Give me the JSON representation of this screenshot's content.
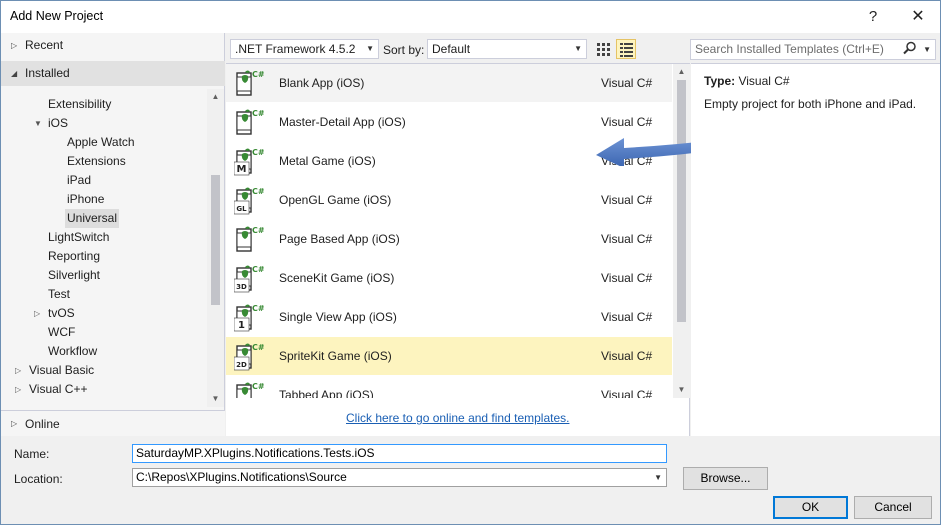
{
  "window": {
    "title": "Add New Project",
    "help_glyph": "?",
    "close_glyph": "✕"
  },
  "left": {
    "recent": "Recent",
    "installed": "Installed",
    "online": "Online",
    "tree": [
      {
        "label": "Extensibility",
        "indent": 1,
        "expander": ""
      },
      {
        "label": "iOS",
        "indent": 1,
        "expander": "▼"
      },
      {
        "label": "Apple Watch",
        "indent": 2,
        "expander": ""
      },
      {
        "label": "Extensions",
        "indent": 2,
        "expander": ""
      },
      {
        "label": "iPad",
        "indent": 2,
        "expander": ""
      },
      {
        "label": "iPhone",
        "indent": 2,
        "expander": ""
      },
      {
        "label": "Universal",
        "indent": 2,
        "expander": "",
        "selected": true
      },
      {
        "label": "LightSwitch",
        "indent": 1,
        "expander": ""
      },
      {
        "label": "Reporting",
        "indent": 1,
        "expander": ""
      },
      {
        "label": "Silverlight",
        "indent": 1,
        "expander": ""
      },
      {
        "label": "Test",
        "indent": 1,
        "expander": ""
      },
      {
        "label": "tvOS",
        "indent": 1,
        "expander": "▷"
      },
      {
        "label": "WCF",
        "indent": 1,
        "expander": ""
      },
      {
        "label": "Workflow",
        "indent": 1,
        "expander": ""
      },
      {
        "label": "Visual Basic",
        "indent": 0,
        "expander": "▷"
      },
      {
        "label": "Visual C++",
        "indent": 0,
        "expander": "▷"
      }
    ]
  },
  "toolbar": {
    "framework": ".NET Framework 4.5.2",
    "sort_label": "Sort by:",
    "sort_value": "Default",
    "search_placeholder": "Search Installed Templates (Ctrl+E)"
  },
  "templates": [
    {
      "name": "Blank App (iOS)",
      "lang": "Visual C#",
      "glyph": "",
      "state": "hover"
    },
    {
      "name": "Master-Detail App (iOS)",
      "lang": "Visual C#",
      "glyph": "",
      "state": ""
    },
    {
      "name": "Metal Game (iOS)",
      "lang": "Visual C#",
      "glyph": "M",
      "state": ""
    },
    {
      "name": "OpenGL Game (iOS)",
      "lang": "Visual C#",
      "glyph": "GL",
      "state": ""
    },
    {
      "name": "Page Based App (iOS)",
      "lang": "Visual C#",
      "glyph": "",
      "state": ""
    },
    {
      "name": "SceneKit Game (iOS)",
      "lang": "Visual C#",
      "glyph": "3D",
      "state": ""
    },
    {
      "name": "Single View App (iOS)",
      "lang": "Visual C#",
      "glyph": "1",
      "state": ""
    },
    {
      "name": "SpriteKit Game (iOS)",
      "lang": "Visual C#",
      "glyph": "2D",
      "state": "selected"
    },
    {
      "name": "Tabbed App (iOS)",
      "lang": "Visual C#",
      "glyph": "",
      "state": ""
    }
  ],
  "online_link": "Click here to go online and find templates.",
  "details": {
    "type_label": "Type:",
    "type_value": "Visual C#",
    "description": "Empty project for both iPhone and iPad."
  },
  "form": {
    "name_label": "Name:",
    "name_value": "SaturdayMP.XPlugins.Notifications.Tests.iOS",
    "location_label": "Location:",
    "location_value": "C:\\Repos\\XPlugins.Notifications\\Source",
    "browse": "Browse...",
    "ok": "OK",
    "cancel": "Cancel"
  },
  "colors": {
    "accent": "#0078d7",
    "selection": "#fdf4bf",
    "arrow": "#4472c4",
    "link": "#1a5fb4"
  }
}
